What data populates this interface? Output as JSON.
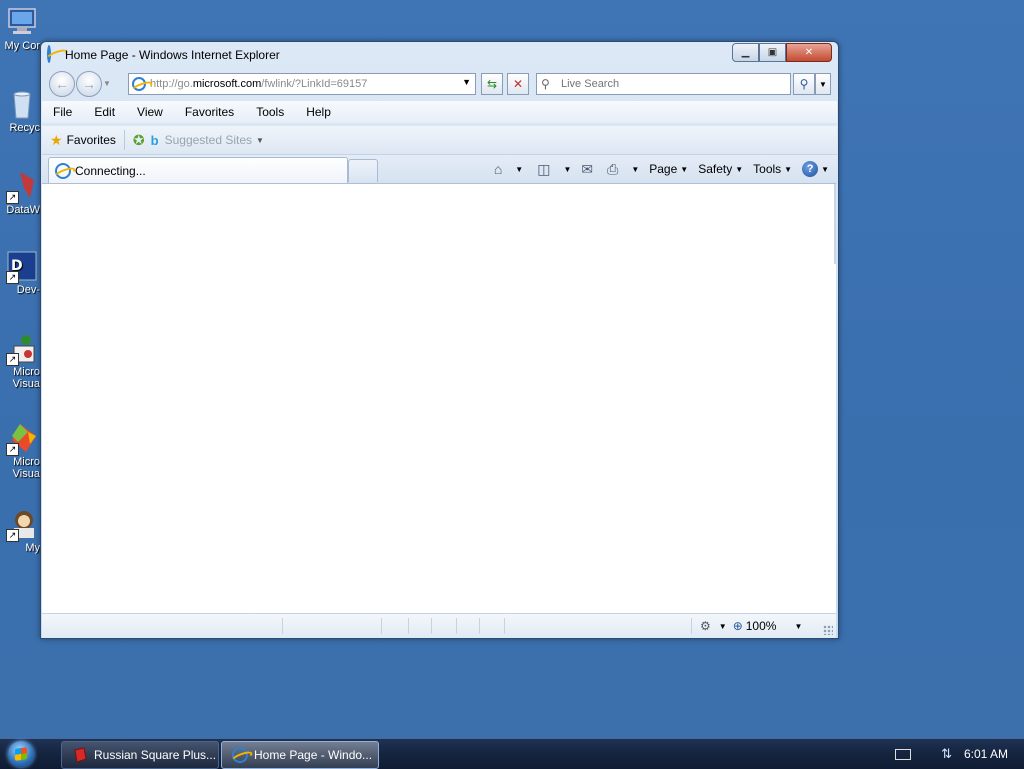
{
  "desktop": {
    "icons": [
      {
        "label": "My Cor"
      },
      {
        "label": "Recyc"
      },
      {
        "label": "DataW"
      },
      {
        "label": "Dev-"
      },
      {
        "label": "Micro\nVisua"
      },
      {
        "label": "Micro\nVisua"
      },
      {
        "label": "My"
      }
    ]
  },
  "window": {
    "title": "Home Page - Windows Internet Explorer",
    "address": {
      "url_prefix": "http://go.",
      "url_domain": "microsoft.com",
      "url_suffix": "/fwlink/?LinkId=69157"
    },
    "search": {
      "placeholder": "Live Search"
    },
    "menu": [
      "File",
      "Edit",
      "View",
      "Favorites",
      "Tools",
      "Help"
    ],
    "favorites": {
      "label": "Favorites",
      "suggested": "Suggested Sites"
    },
    "tab": {
      "label": "Connecting..."
    },
    "commands": {
      "page": "Page",
      "safety": "Safety",
      "tools": "Tools"
    },
    "status": {
      "zoom": "100%"
    }
  },
  "taskbar": {
    "tasks": [
      {
        "label": "Russian Square Plus...",
        "active": false
      },
      {
        "label": "Home Page - Windo...",
        "active": true
      }
    ],
    "clock": "6:01 AM"
  },
  "colors": {
    "desktop": "#3a6ea5",
    "taskbar": "#162540",
    "accent": "#2e7fd6"
  }
}
